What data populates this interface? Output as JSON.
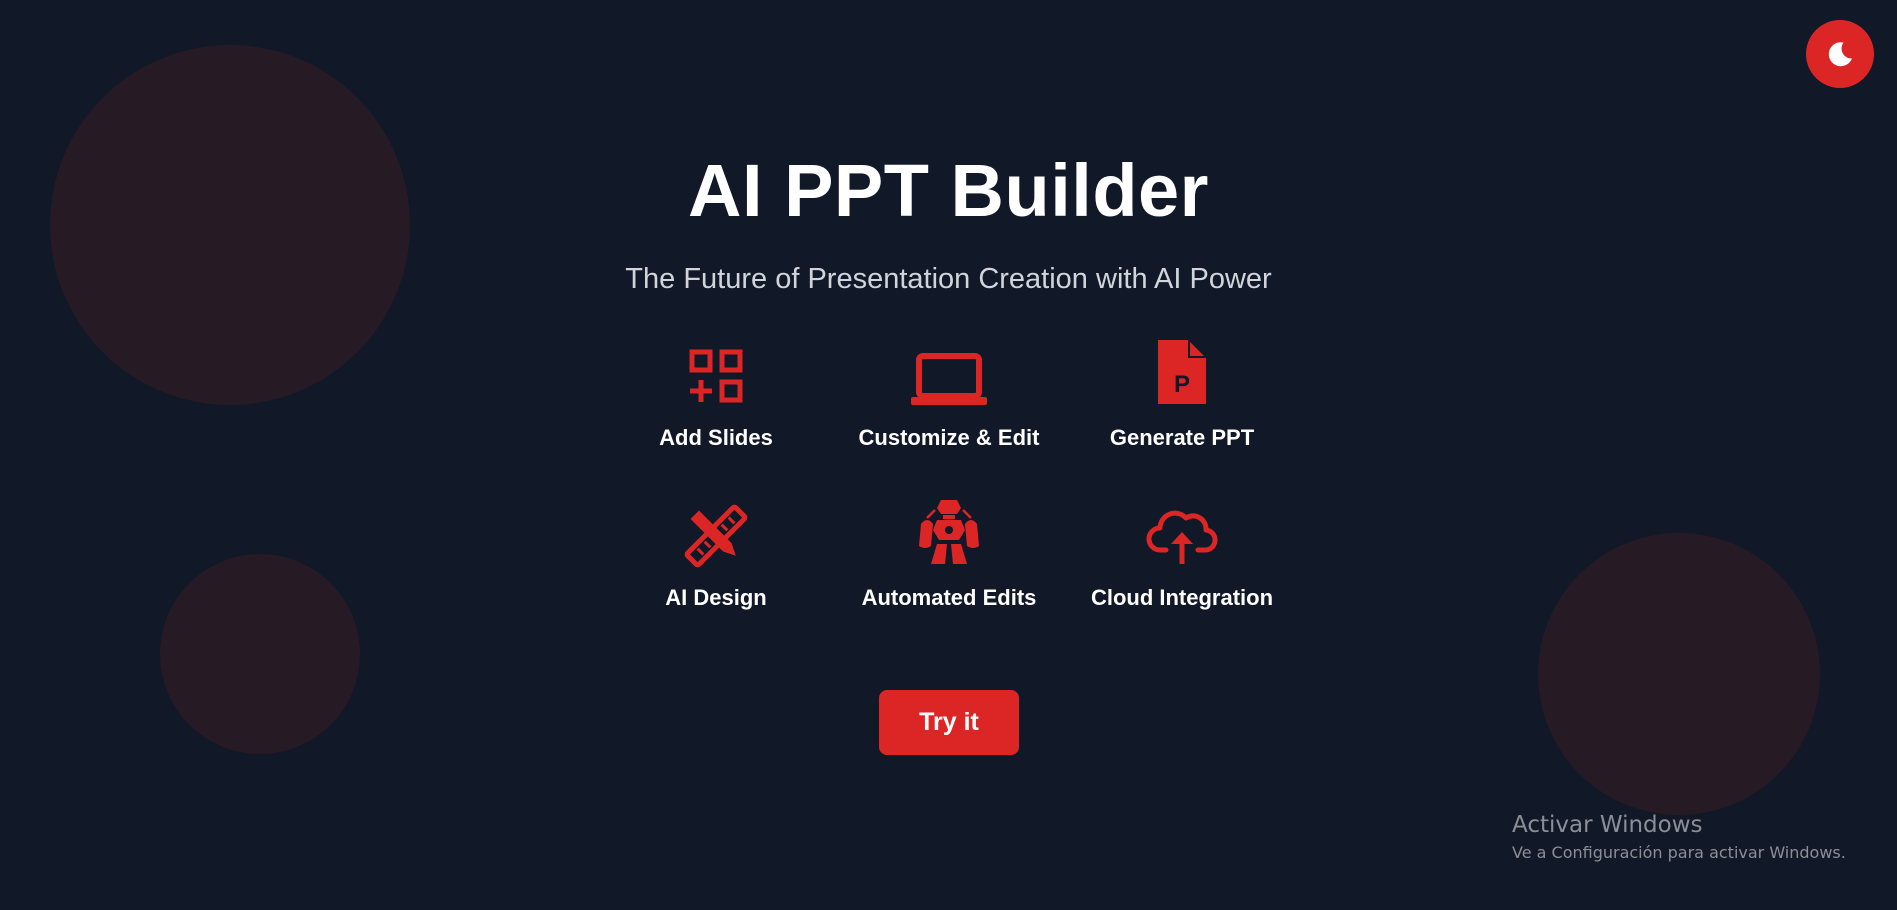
{
  "theme": {
    "background": "#111827",
    "accent": "#dc2626",
    "bubble": "#261a25",
    "title_color": "#ffffff",
    "subtitle_color": "#d1d5db"
  },
  "theme_toggle": {
    "icon": "moon-icon"
  },
  "hero": {
    "title": "AI PPT Builder",
    "subtitle": "The Future of Presentation Creation with AI Power"
  },
  "features": [
    {
      "label": "Add Slides",
      "icon": "add-slides-grid-icon"
    },
    {
      "label": "Customize & Edit",
      "icon": "laptop-icon"
    },
    {
      "label": "Generate PPT",
      "icon": "ppt-file-icon"
    },
    {
      "label": "AI Design",
      "icon": "pencil-ruler-icon"
    },
    {
      "label": "Automated Edits",
      "icon": "robot-icon"
    },
    {
      "label": "Cloud Integration",
      "icon": "cloud-upload-icon"
    }
  ],
  "cta": {
    "label": "Try it"
  },
  "os_watermark": {
    "title": "Activar Windows",
    "subtitle": "Ve a Configuración para activar Windows."
  }
}
